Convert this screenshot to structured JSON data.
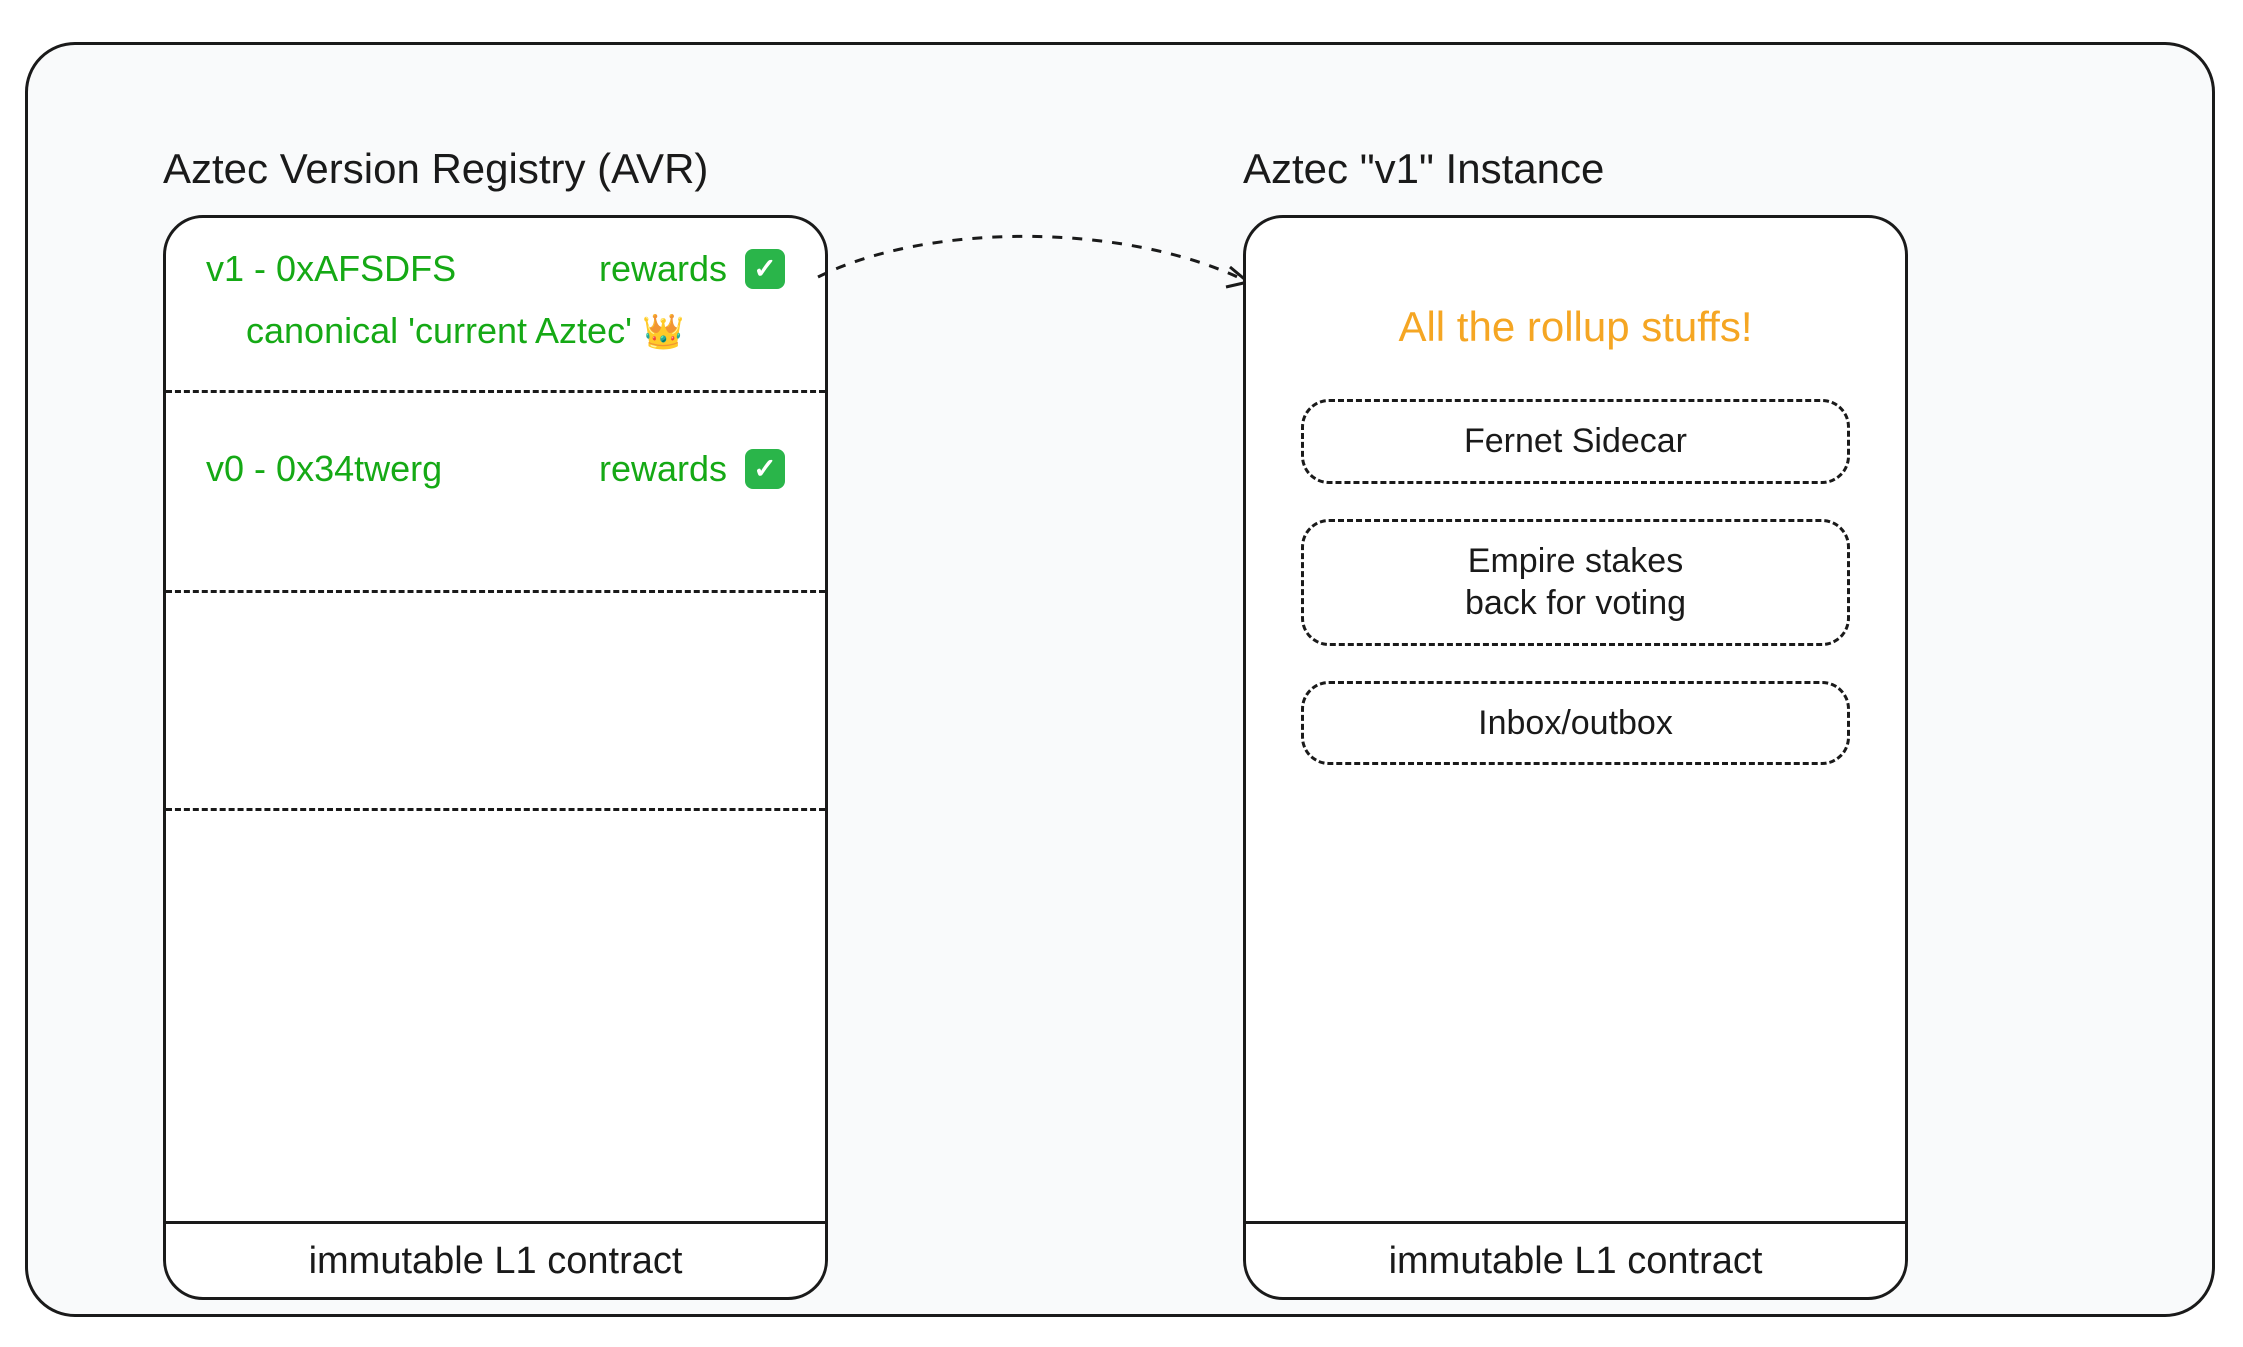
{
  "avr": {
    "title": "Aztec Version Registry (AVR)",
    "footer": "immutable L1 contract",
    "entries": [
      {
        "version": "v1",
        "address": "0xAFSDFS",
        "rewards_label": "rewards",
        "rewards_enabled": true,
        "canonical_label": "canonical 'current Aztec'",
        "is_canonical": true
      },
      {
        "version": "v0",
        "address": "0x34twerg",
        "rewards_label": "rewards",
        "rewards_enabled": true,
        "is_canonical": false
      }
    ]
  },
  "instance": {
    "title": "Aztec \"v1\" Instance",
    "headline": "All the rollup stuffs!",
    "footer": "immutable L1 contract",
    "components": [
      "Fernet Sidecar",
      "Empire stakes\nback for voting",
      "Inbox/outbox"
    ]
  },
  "colors": {
    "text": "#1a1a1a",
    "green": "#15a915",
    "orange": "#f5a623",
    "bg": "#f9fafb"
  }
}
